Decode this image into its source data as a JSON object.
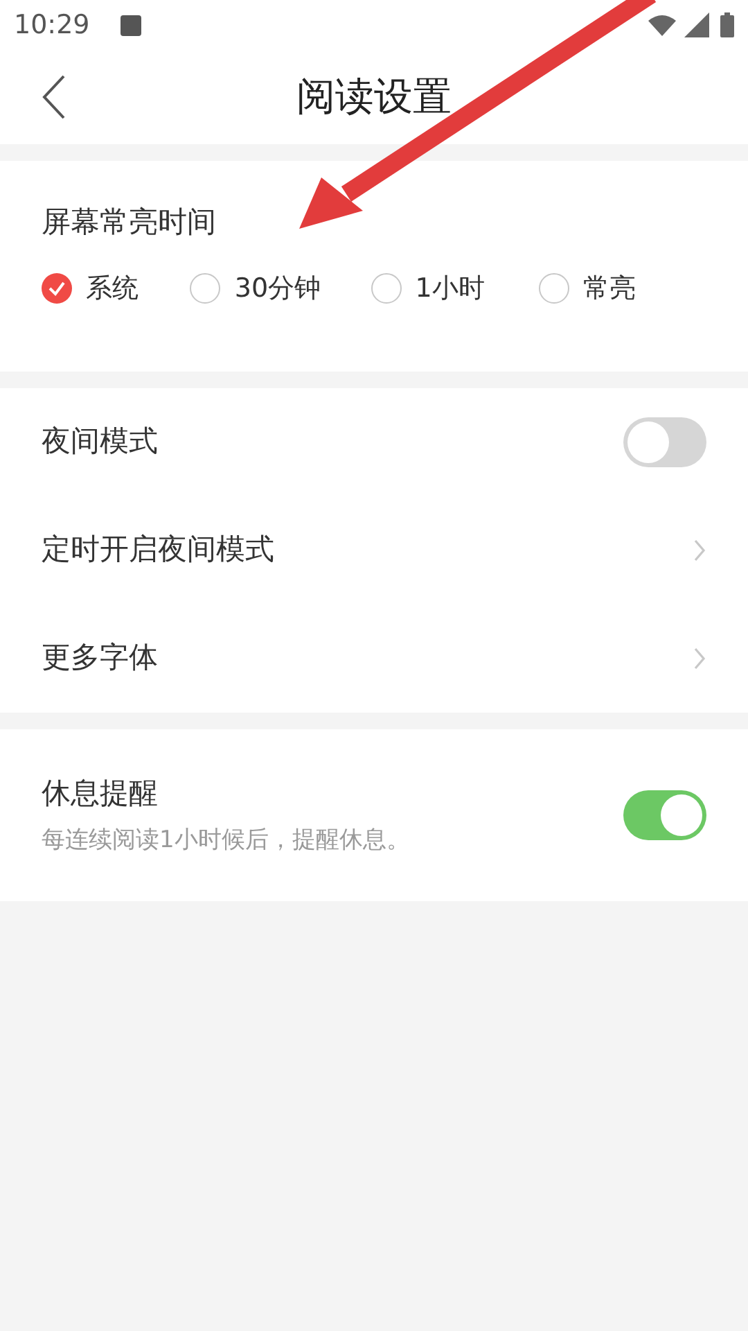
{
  "status_bar": {
    "time": "10:29"
  },
  "header": {
    "title": "阅读设置"
  },
  "screen_timeout": {
    "title": "屏幕常亮时间",
    "options": [
      {
        "label": "系统",
        "selected": true
      },
      {
        "label": "30分钟",
        "selected": false
      },
      {
        "label": "1小时",
        "selected": false
      },
      {
        "label": "常亮",
        "selected": false
      }
    ]
  },
  "settings": [
    {
      "kind": "toggle",
      "label": "夜间模式",
      "on": false
    },
    {
      "kind": "link",
      "label": "定时开启夜间模式"
    },
    {
      "kind": "link",
      "label": "更多字体"
    }
  ],
  "rest_reminder": {
    "kind": "toggle",
    "label": "休息提醒",
    "description": "每连续阅读1小时候后，提醒休息。",
    "on": true
  }
}
